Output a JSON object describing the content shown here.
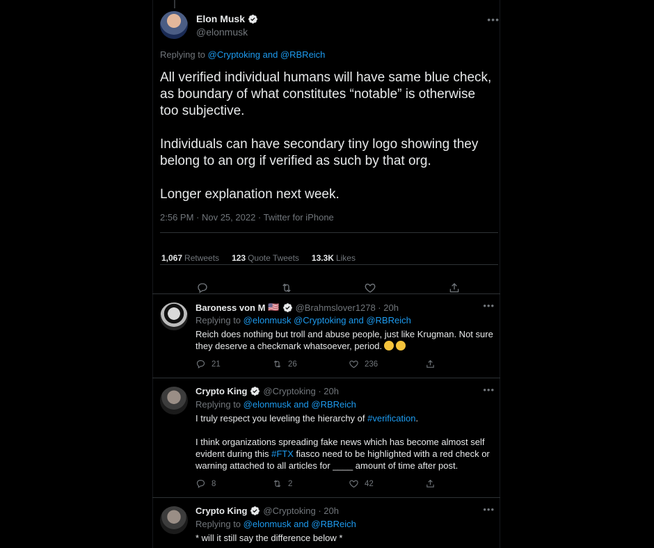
{
  "main_tweet": {
    "author_name": "Elon Musk",
    "handle": "@elonmusk",
    "replying_prefix": "Replying to ",
    "replying_mention1": "@Cryptoking",
    "replying_and": " and ",
    "replying_mention2": "@RBReich",
    "text": "All verified individual humans will have same blue check, as boundary of what constitutes “notable” is otherwise too subjective.\n\nIndividuals can have secondary tiny logo showing they belong to an org if verified as such by that org.\n\nLonger explanation next week.",
    "meta": "2:56 PM · Nov 25, 2022 · Twitter for iPhone",
    "retweets_count": "1,067",
    "retweets_label": "Retweets",
    "quotes_count": "123",
    "quotes_label": "Quote Tweets",
    "likes_count": "13.3K",
    "likes_label": "Likes"
  },
  "replies": [
    {
      "name": "Baroness von M",
      "flag": "🇺🇸",
      "handle": "@Brahmslover1278 · 20h",
      "replying_prefix": "Replying to ",
      "replying_mentions": "@elonmusk @Cryptoking and @RBReich",
      "text": "Reich does nothing but troll and abuse people, just like Krugman. Not sure they deserve a checkmark whatsoever, period.",
      "replies": "21",
      "retweets": "26",
      "likes": "236"
    },
    {
      "name": "Crypto King",
      "handle": "@Cryptoking · 20h",
      "replying_prefix": "Replying to ",
      "replying_mentions": "@elonmusk and @RBReich",
      "text_part1": "I truly respect you leveling the hierarchy of ",
      "tag1": "#verification",
      "text_part2": ".",
      "text_part3": "I think organizations spreading fake news which has become almost self evident during this ",
      "tag2": "#FTX",
      "text_part4": " fiasco need to be highlighted with a red check or warning attached to all articles for ____ amount of time after post.",
      "replies": "8",
      "retweets": "2",
      "likes": "42"
    },
    {
      "name": "Crypto King",
      "handle": "@Cryptoking · 20h",
      "replying_prefix": "Replying to ",
      "replying_mentions": "@elonmusk and @RBReich",
      "text": "* will it still say the difference below *"
    }
  ],
  "icons": {
    "verified": "verified-badge-icon",
    "more": "more-icon",
    "reply": "reply-icon",
    "retweet": "retweet-icon",
    "like": "heart-icon",
    "share": "share-icon"
  },
  "colors": {
    "background": "#000000",
    "accent": "#1d9bf0",
    "muted": "#71767b",
    "text": "#e7e9ea",
    "border": "#2f3336"
  }
}
